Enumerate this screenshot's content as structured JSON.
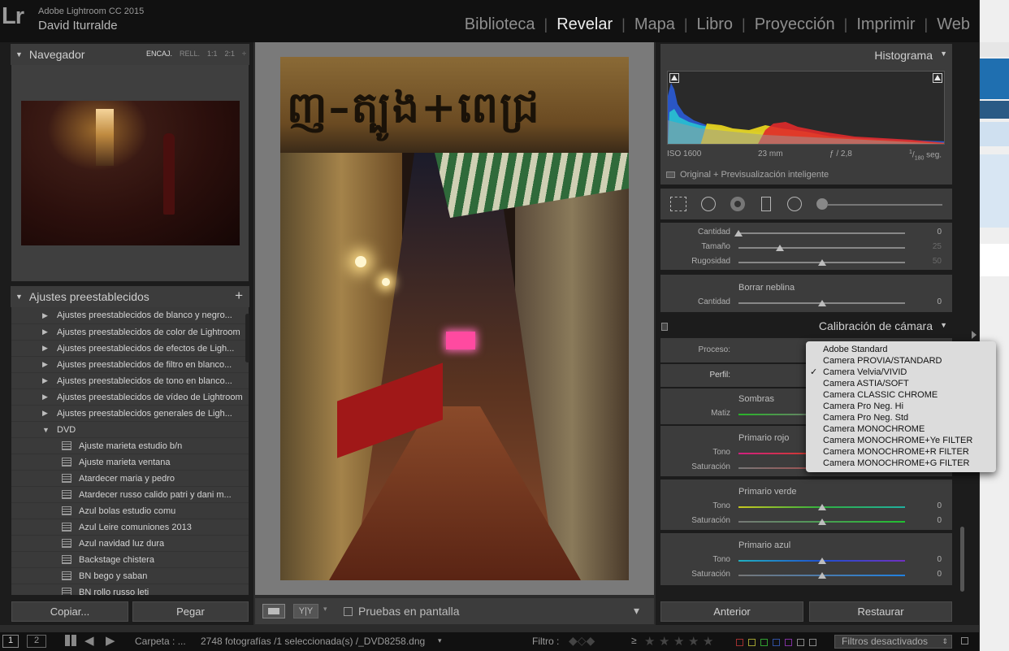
{
  "app": {
    "logo": "Lr",
    "name": "Adobe Lightroom CC 2015",
    "user": "David Iturralde"
  },
  "modules": [
    "Biblioteca",
    "Revelar",
    "Mapa",
    "Libro",
    "Proyección",
    "Imprimir",
    "Web"
  ],
  "active_module": "Revelar",
  "navigator": {
    "title": "Navegador",
    "zoom": [
      "ENCAJ.",
      "RELL.",
      "1:1",
      "2:1"
    ],
    "zoom_selected": "ENCAJ.",
    "zoom_menu": "÷"
  },
  "presets": {
    "title": "Ajustes preestablecidos",
    "add": "+",
    "folders": [
      "Ajustes preestablecidos de blanco y negro...",
      "Ajustes preestablecidos de color de Lightroom",
      "Ajustes preestablecidos de efectos de Ligh...",
      "Ajustes preestablecidos de filtro en blanco...",
      "Ajustes preestablecidos de tono en blanco...",
      "Ajustes preestablecidos de vídeo de Lightroom",
      "Ajustes preestablecidos generales de Ligh..."
    ],
    "open_folder": "DVD",
    "items": [
      "Ajuste marieta estudio b/n",
      "Ajuste marieta ventana",
      "Atardecer maria y pedro",
      "Atardecer russo calido patri y dani m...",
      "Azul bolas estudio comu",
      "Azul Leire comuniones 2013",
      "Azul navidad luz dura",
      "Backstage chistera",
      "BN bego y saban",
      "BN rollo russo leti"
    ]
  },
  "left_buttons": {
    "copy": "Copiar...",
    "paste": "Pegar"
  },
  "toolbar": {
    "softproof": "Pruebas en pantalla",
    "yy": "Y|Y",
    "menu": "▾"
  },
  "histogram": {
    "title": "Histograma",
    "iso": "ISO 1600",
    "focal": "23 mm",
    "aperture": "ƒ / 2,8",
    "shutter_num": "1",
    "shutter_den": "180",
    "shutter_unit": "seg.",
    "preview_label": "Original + Previsualización inteligente",
    "colors": {
      "blue": "#2a5bd6",
      "cyan": "#29c2d0",
      "yellow": "#e6d21e",
      "red": "#e02a2a",
      "gray": "#9a9a9a"
    }
  },
  "detail_noise": {
    "labels": [
      "Cantidad",
      "Tamaño",
      "Rugosidad"
    ],
    "values": [
      "0",
      "25",
      "50"
    ],
    "levels": [
      0,
      0.25,
      0.5
    ]
  },
  "effects": {
    "dehaze_title": "Borrar neblina",
    "label": "Cantidad",
    "value": "0",
    "level": 0.5
  },
  "calibration": {
    "title": "Calibración de cámara",
    "process_label": "Proceso:",
    "profile_label": "Perfil:",
    "shadows_title": "Sombras",
    "shadows_label": "Matiz",
    "red_title": "Primario rojo",
    "green_title": "Primario verde",
    "blue_title": "Primario azul",
    "hue_label": "Tono",
    "sat_label": "Saturación",
    "green_values": [
      "0",
      "0"
    ],
    "blue_values": [
      "0",
      "0"
    ],
    "slider_level": 0.5
  },
  "profile_menu": {
    "options": [
      "Adobe Standard",
      "Camera PROVIA/STANDARD",
      "Camera Velvia/VIVID",
      "Camera ASTIA/SOFT",
      "Camera CLASSIC CHROME",
      "Camera Pro Neg. Hi",
      "Camera Pro Neg. Std",
      "Camera MONOCHROME",
      "Camera MONOCHROME+Ye FILTER",
      "Camera MONOCHROME+R FILTER",
      "Camera MONOCHROME+G FILTER"
    ],
    "checked": "Camera Velvia/VIVID",
    "check_mark": "✓"
  },
  "right_buttons": {
    "previous": "Anterior",
    "reset": "Restaurar"
  },
  "filmstrip": {
    "page1": "1",
    "page2": "2",
    "folder": "Carpeta : ...",
    "count": "2748 fotografías /1 seleccionada(s) /_DVD8258.dng",
    "filter_label": "Filtro :",
    "rating_op": "≥",
    "filters_off": "Filtros desactivados"
  }
}
